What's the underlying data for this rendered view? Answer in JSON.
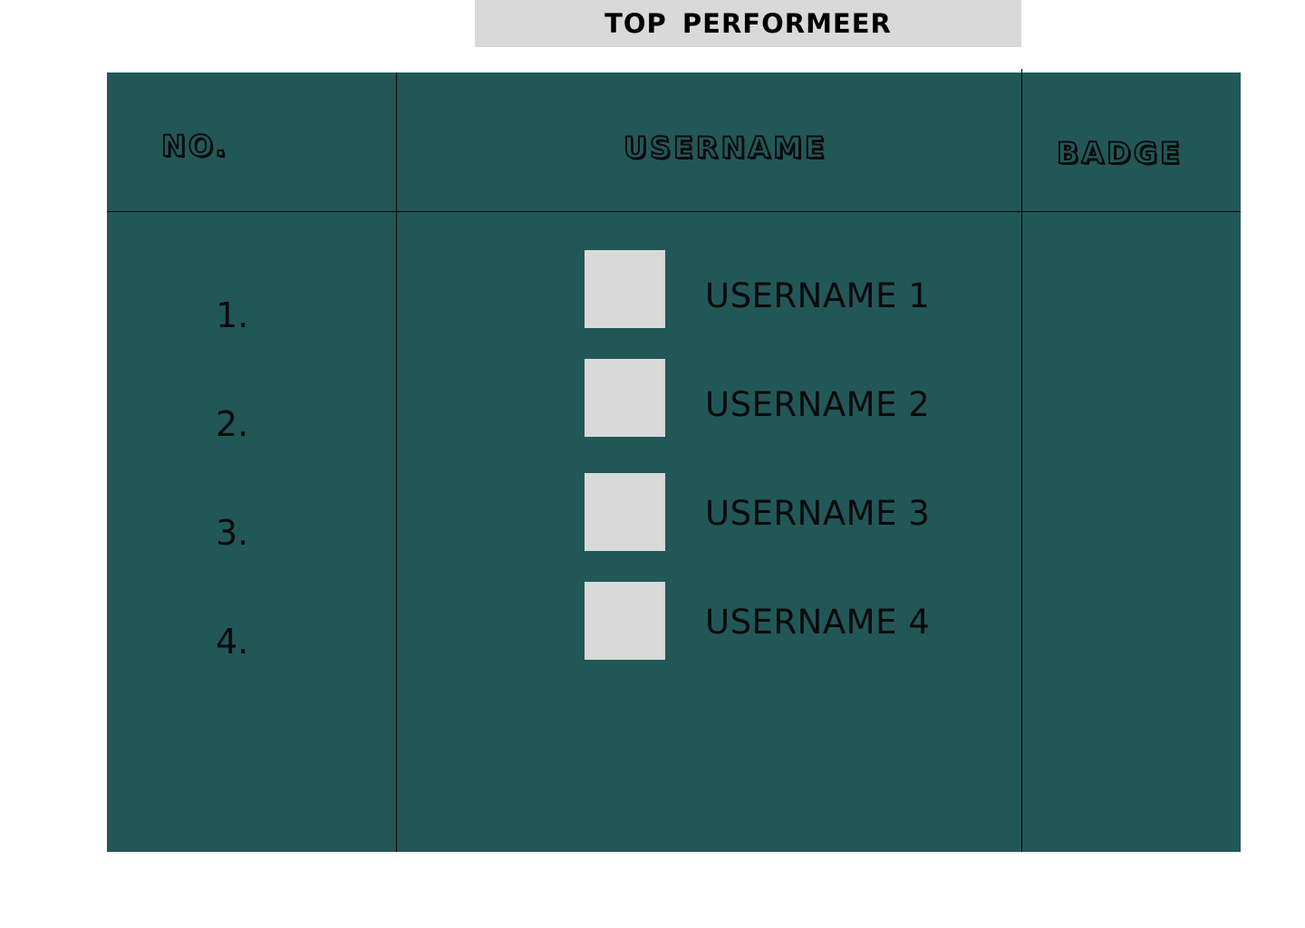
{
  "title": "TOP  PERFORMEER",
  "headers": {
    "no": "NO.",
    "username": "USERNAME",
    "badge": "BADGE"
  },
  "rows": [
    {
      "no": "1.",
      "username": "USERNAME 1",
      "avatar_icon": "avatar-placeholder"
    },
    {
      "no": "2.",
      "username": "USERNAME 2",
      "avatar_icon": "avatar-placeholder"
    },
    {
      "no": "3.",
      "username": "USERNAME 3",
      "avatar_icon": "avatar-placeholder"
    },
    {
      "no": "4.",
      "username": "USERNAME 4",
      "avatar_icon": "avatar-placeholder"
    }
  ],
  "colors": {
    "panel": "#225758",
    "title_bar": "#d9d9d9",
    "avatar": "#d9d9d9",
    "lines": "#000000"
  }
}
